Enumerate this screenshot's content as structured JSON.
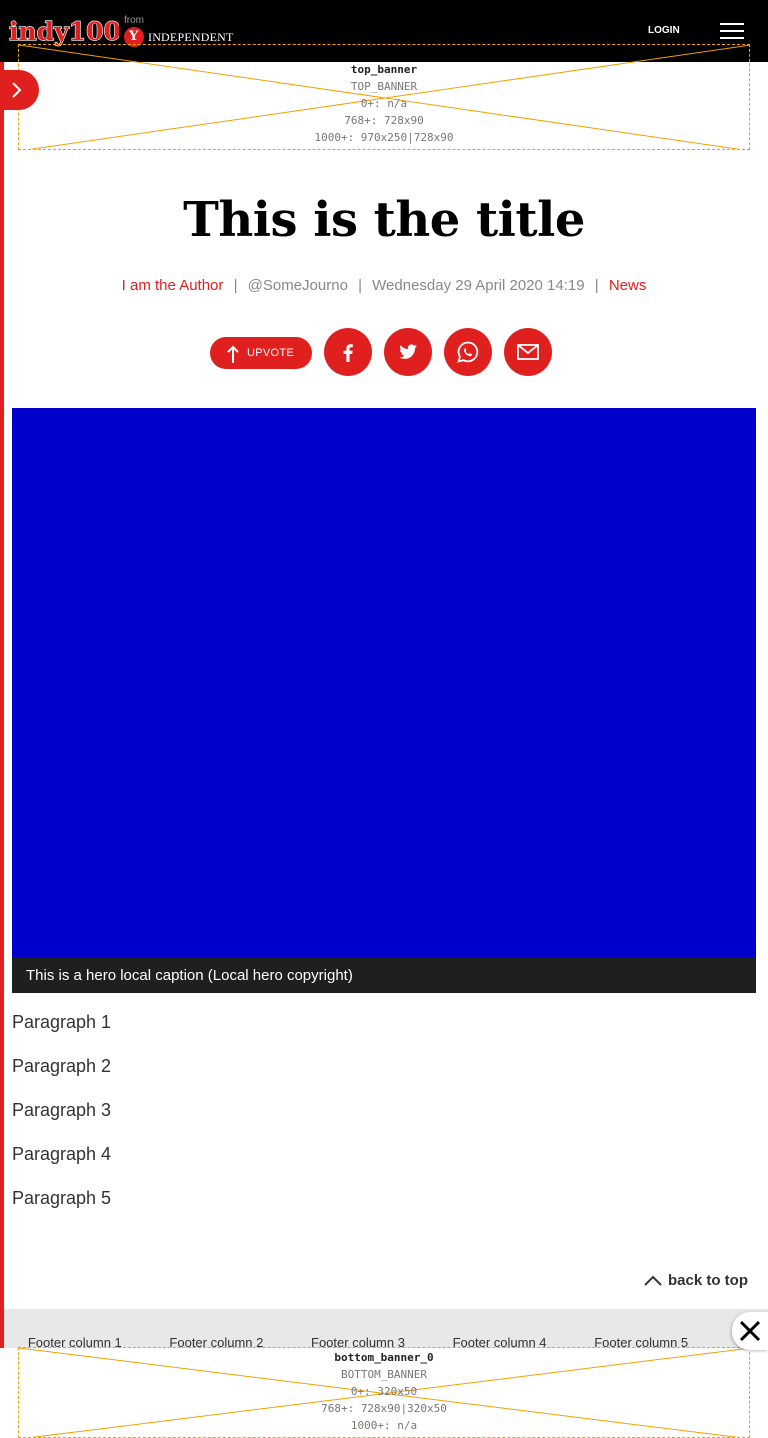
{
  "header": {
    "logo_text": "indy100",
    "from_label": "from",
    "partner_logo_text": "INDEPENDENT",
    "login_label": "LOGIN",
    "menu_icon": "hamburger-menu-icon"
  },
  "top_banner": {
    "name": "top_banner",
    "id_label": "TOP_BANNER",
    "line1": "0+: n/a",
    "line2": "768+: 728x90",
    "line3": "1000+: 970x250|728x90"
  },
  "article": {
    "title": "This is the title",
    "author": "I am the Author",
    "handle": "@SomeJourno",
    "date": "Wednesday 29 April 2020 14:19",
    "section": "News",
    "separator": "|"
  },
  "share": {
    "upvote_label": "UPVOTE",
    "icons": [
      "facebook-icon",
      "twitter-icon",
      "whatsapp-icon",
      "email-icon"
    ]
  },
  "hero": {
    "caption": "This is a hero local caption (Local hero copyright)",
    "color": "#0000cc"
  },
  "body": {
    "paragraphs": [
      "Paragraph 1",
      "Paragraph 2",
      "Paragraph 3",
      "Paragraph 4",
      "Paragraph 5"
    ]
  },
  "back_to_top_label": "back to top",
  "footer": {
    "columns": [
      "Footer column 1",
      "Footer column 2",
      "Footer column 3",
      "Footer column 4",
      "Footer column 5"
    ]
  },
  "bottom_banner": {
    "name": "bottom_banner_0",
    "id_label": "BOTTOM_BANNER",
    "line1": "0+: 320x50",
    "line2": "768+: 728x90|320x50",
    "line3": "1000+: n/a"
  },
  "colors": {
    "accent": "#e0201f",
    "header_bg": "#000000",
    "ad_border": "#f2a100",
    "footer_bg": "#e8e8e8"
  }
}
